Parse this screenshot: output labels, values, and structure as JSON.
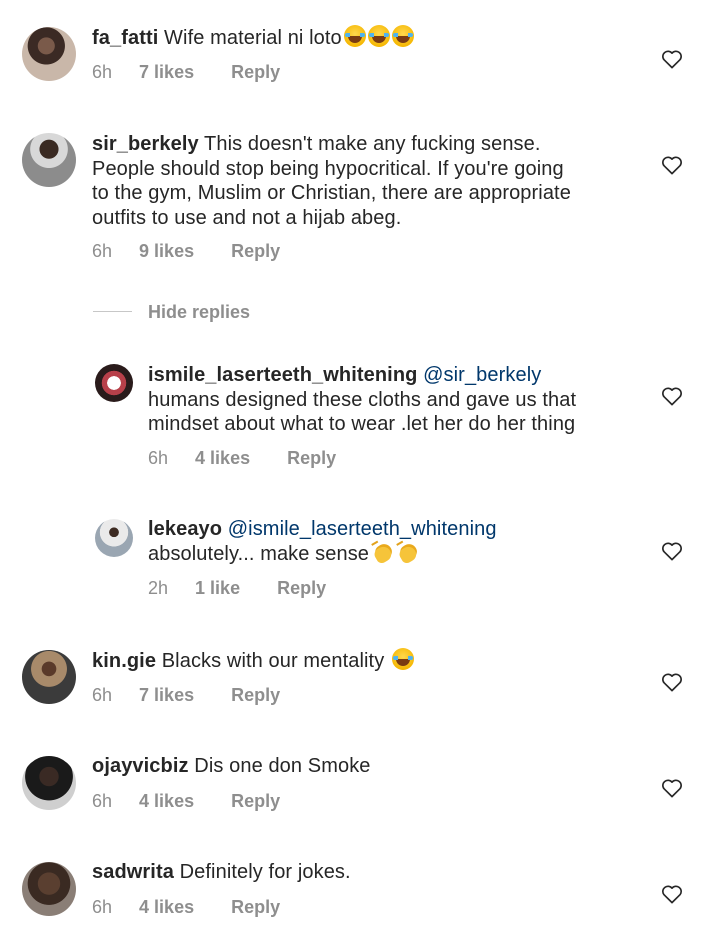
{
  "comments": [
    {
      "user": "fa_fatti",
      "text": "Wife material ni loto",
      "emoji": "laughing-tears x3",
      "time": "6h",
      "likes": "7 likes",
      "reply": "Reply"
    },
    {
      "user": "sir_berkely",
      "text": "This doesn't make any fucking sense.",
      "lines": [
        "People should stop being hypocritical. If you're going",
        "to the gym, Muslim or Christian, there are appropriate",
        "outfits to use and not a hijab abeg."
      ],
      "time": "6h",
      "likes": "9 likes",
      "reply": "Reply"
    },
    {
      "user": "ismile_laserteeth_whitening",
      "mention": "@sir_berkely",
      "lines": [
        "humans designed these cloths and gave us that",
        "mindset about what to wear .let her do her thing"
      ],
      "time": "6h",
      "likes": "4 likes",
      "reply": "Reply"
    },
    {
      "user": "lekeayo",
      "mention": "@ismile_laserteeth_whitening",
      "text": "absolutely... make sense",
      "emoji": "clapping-hands x2",
      "time": "2h",
      "likes": "1 like",
      "reply": "Reply"
    },
    {
      "user": "kin.gie",
      "text": "Blacks with our mentality",
      "emoji": "laughing-tears",
      "time": "6h",
      "likes": "7 likes",
      "reply": "Reply"
    },
    {
      "user": "ojayvicbiz",
      "text": "Dis one don Smoke",
      "time": "6h",
      "likes": "4 likes",
      "reply": "Reply"
    },
    {
      "user": "sadwrita",
      "text": "Definitely for jokes.",
      "time": "6h",
      "likes": "4 likes",
      "reply": "Reply"
    }
  ],
  "hide_replies": "Hide replies",
  "colors": {
    "username": "#262626",
    "mention": "#00376b",
    "meta": "#8e8e8e",
    "heart_stroke": "#262626"
  },
  "icons": {
    "like": "heart-outline-icon",
    "laugh": "laughing-tears-emoji",
    "clap": "clapping-hands-emoji"
  }
}
